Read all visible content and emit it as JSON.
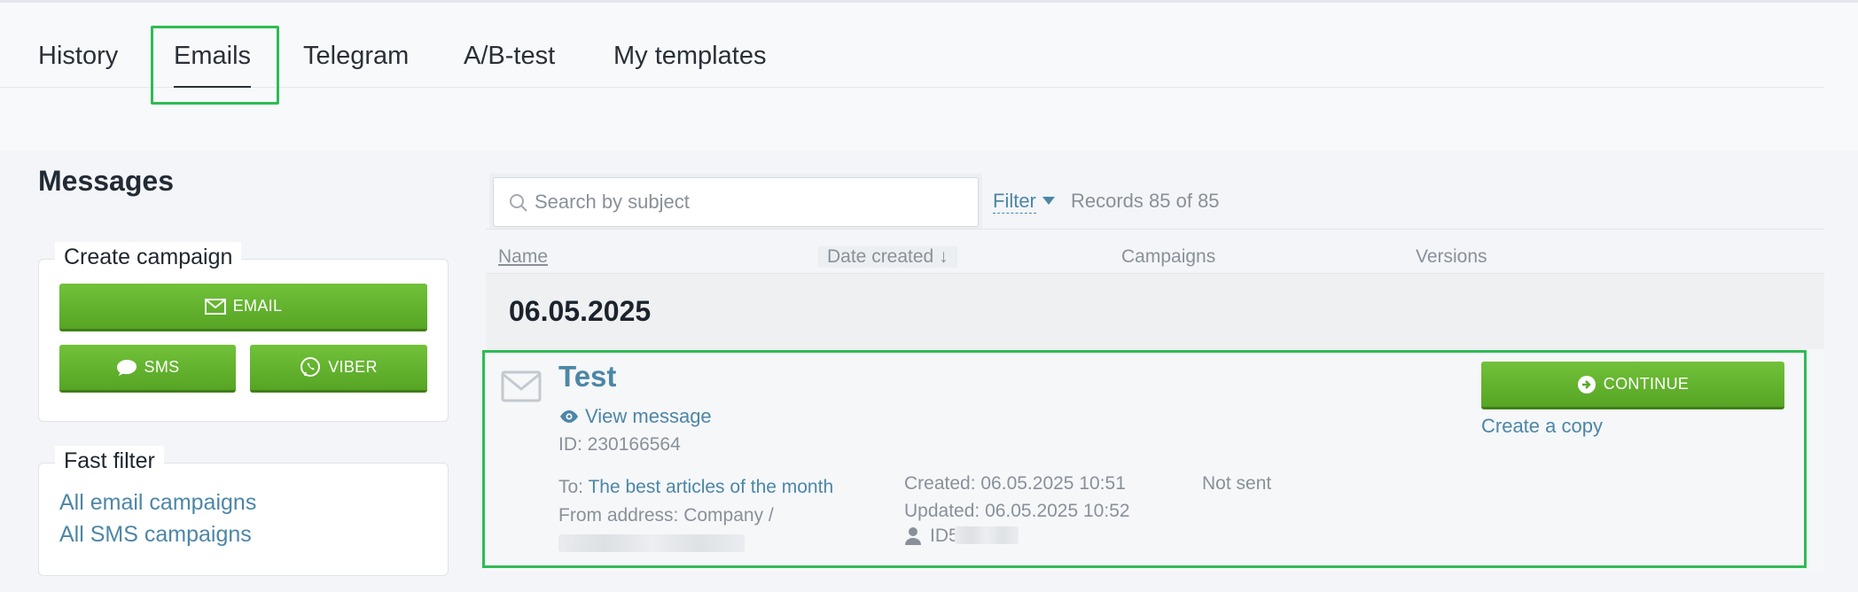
{
  "tabs": [
    {
      "label": "History"
    },
    {
      "label": "Emails"
    },
    {
      "label": "Telegram"
    },
    {
      "label": "A/B-test"
    },
    {
      "label": "My templates"
    }
  ],
  "active_tab": "Emails",
  "sidebar": {
    "title": "Messages",
    "create_campaign": {
      "legend": "Create campaign",
      "email_label": "EMAIL",
      "sms_label": "SMS",
      "viber_label": "VIBER"
    },
    "fast_filter": {
      "legend": "Fast filter",
      "links": [
        "All email campaigns",
        "All SMS campaigns"
      ]
    }
  },
  "toolbar": {
    "search_placeholder": "Search by subject",
    "filter_label": "Filter",
    "records_text": "Records 85 of 85"
  },
  "table": {
    "columns": {
      "name": "Name",
      "date_created": "Date created ↓",
      "campaigns": "Campaigns",
      "versions": "Versions"
    },
    "groups": [
      {
        "date": "06.05.2025",
        "items": [
          {
            "title": "Test",
            "view_label": "View message",
            "id_text": "ID: 230166564",
            "to_prefix": "To:",
            "to_list": "The best articles of the month",
            "from_text": "From address: Company /",
            "created": "Created: 06.05.2025 10:51",
            "updated": "Updated: 06.05.2025 10:52",
            "author_id": "ID5",
            "status": "Not sent",
            "continue_label": "CONTINUE",
            "copy_label": "Create a copy"
          }
        ]
      }
    ]
  },
  "colors": {
    "accent_green": "#56a524",
    "highlight_green": "#2fbb55",
    "link_blue": "#4d86a6"
  }
}
